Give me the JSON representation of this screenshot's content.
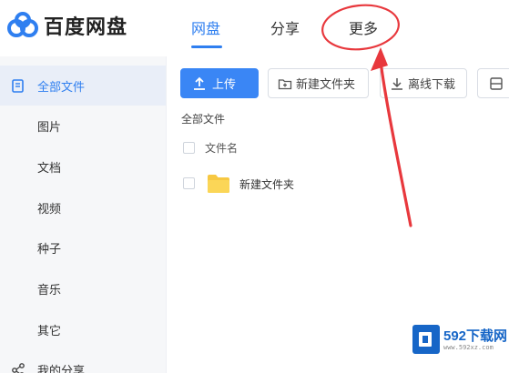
{
  "app": {
    "name": "百度网盘"
  },
  "nav": {
    "tabs": [
      {
        "label": "网盘",
        "active": true
      },
      {
        "label": "分享",
        "active": false
      },
      {
        "label": "更多",
        "active": false
      }
    ]
  },
  "sidebar": {
    "items": [
      {
        "label": "全部文件",
        "icon": "file-icon",
        "active": true
      },
      {
        "label": "图片",
        "active": false
      },
      {
        "label": "文档",
        "active": false
      },
      {
        "label": "视频",
        "active": false
      },
      {
        "label": "种子",
        "active": false
      },
      {
        "label": "音乐",
        "active": false
      },
      {
        "label": "其它",
        "active": false
      },
      {
        "label": "我的分享",
        "icon": "share-icon",
        "active": false
      }
    ]
  },
  "toolbar": {
    "upload_label": "上传",
    "new_folder_label": "新建文件夹",
    "offline_download_label": "离线下载"
  },
  "breadcrumb": "全部文件",
  "file_list": {
    "column_name": "文件名",
    "rows": [
      {
        "name": "新建文件夹",
        "type": "folder"
      }
    ]
  },
  "watermark": {
    "brand": "592下载网",
    "url": "www.592xz.com"
  },
  "colors": {
    "accent": "#2f7ff0",
    "annotation": "#e8383d"
  }
}
